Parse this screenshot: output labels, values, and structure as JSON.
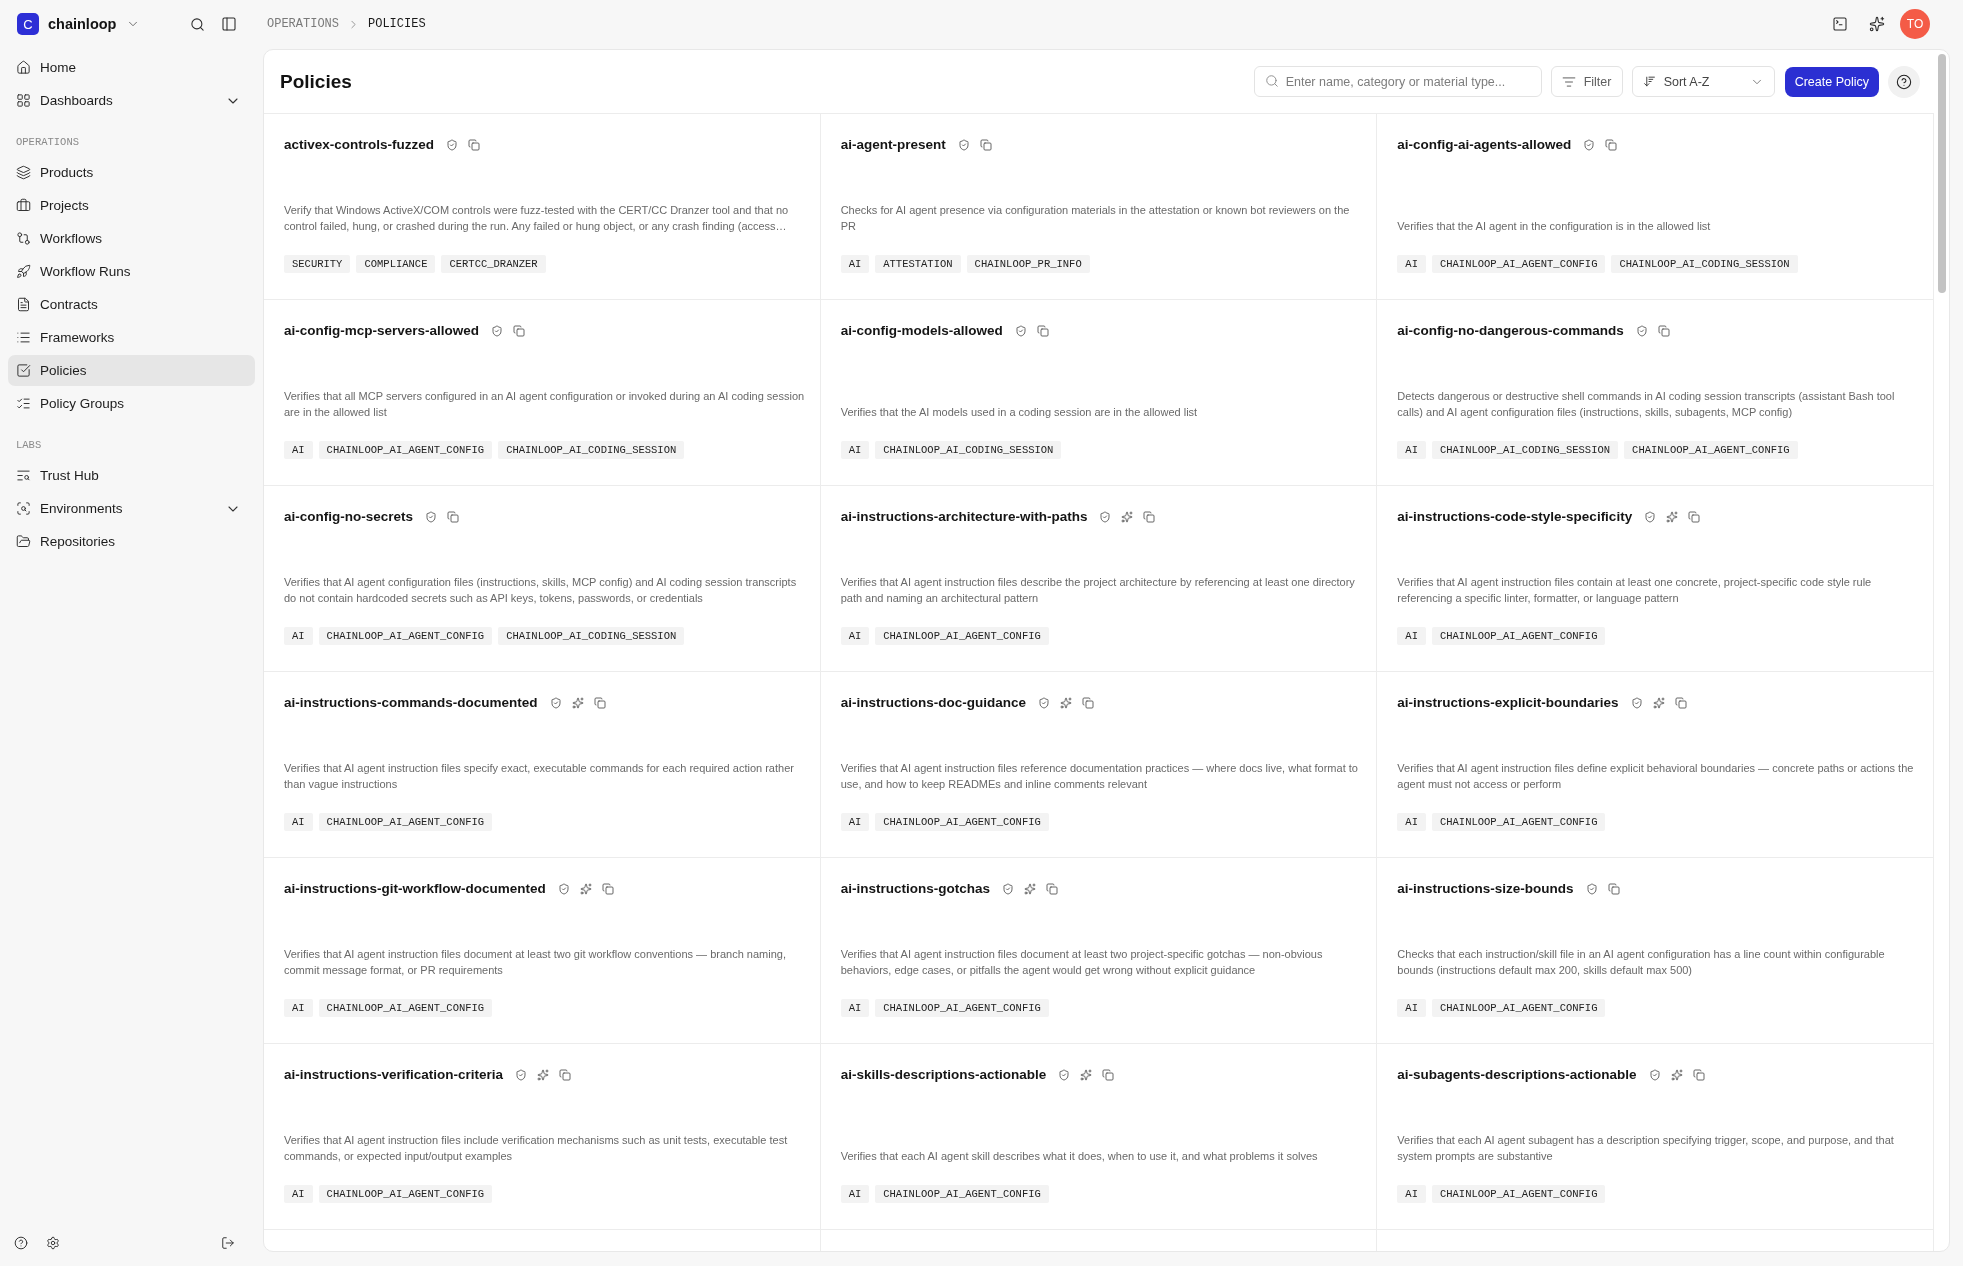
{
  "sidebar": {
    "brand": {
      "initial": "C",
      "name": "chainloop"
    },
    "sections": [
      {
        "items": [
          {
            "label": "Home",
            "selected": false
          },
          {
            "label": "Dashboards",
            "selected": false,
            "expanded": false
          }
        ]
      },
      {
        "title": "OPERATIONS",
        "items": [
          {
            "label": "Products",
            "selected": false
          },
          {
            "label": "Projects",
            "selected": false
          },
          {
            "label": "Workflows",
            "selected": false
          },
          {
            "label": "Workflow Runs",
            "selected": false
          },
          {
            "label": "Contracts",
            "selected": false
          },
          {
            "label": "Frameworks",
            "selected": false
          },
          {
            "label": "Policies",
            "selected": true
          },
          {
            "label": "Policy Groups",
            "selected": false
          }
        ]
      },
      {
        "title": "LABS",
        "items": [
          {
            "label": "Trust Hub",
            "selected": false
          },
          {
            "label": "Environments",
            "selected": false,
            "expanded": false
          },
          {
            "label": "Repositories",
            "selected": false
          }
        ]
      }
    ]
  },
  "breadcrumb": [
    "OPERATIONS",
    "POLICIES"
  ],
  "user": {
    "initials": "TO"
  },
  "page": {
    "title": "Policies",
    "search": {
      "placeholder": "Enter name, category or material type..."
    },
    "filter_button": "Filter",
    "sort": {
      "value": "Sort A-Z"
    },
    "create_button": "Create Policy"
  },
  "policies": [
    {
      "name": "activex-controls-fuzzed",
      "sparkle_badge": false,
      "description": "Verify that Windows ActiveX/COM controls were fuzz-tested with the CERT/CC Dranzer tool and that no control failed, hung, or crashed during the run. Any failed or hung object, or any crash finding (access…",
      "tags": [
        "SECURITY",
        "COMPLIANCE",
        "CERTCC_DRANZER"
      ]
    },
    {
      "name": "ai-agent-present",
      "sparkle_badge": false,
      "description": "Checks for AI agent presence via configuration materials in the attestation or known bot reviewers on the PR",
      "tags": [
        "AI",
        "ATTESTATION",
        "CHAINLOOP_PR_INFO"
      ]
    },
    {
      "name": "ai-config-ai-agents-allowed",
      "sparkle_badge": false,
      "description": "Verifies that the AI agent in the configuration is in the allowed list",
      "tags": [
        "AI",
        "CHAINLOOP_AI_AGENT_CONFIG",
        "CHAINLOOP_AI_CODING_SESSION"
      ]
    },
    {
      "name": "ai-config-mcp-servers-allowed",
      "sparkle_badge": false,
      "description": "Verifies that all MCP servers configured in an AI agent configuration or invoked during an AI coding session are in the allowed list",
      "tags": [
        "AI",
        "CHAINLOOP_AI_AGENT_CONFIG",
        "CHAINLOOP_AI_CODING_SESSION"
      ]
    },
    {
      "name": "ai-config-models-allowed",
      "sparkle_badge": false,
      "description": "Verifies that the AI models used in a coding session are in the allowed list",
      "tags": [
        "AI",
        "CHAINLOOP_AI_CODING_SESSION"
      ]
    },
    {
      "name": "ai-config-no-dangerous-commands",
      "sparkle_badge": false,
      "description": "Detects dangerous or destructive shell commands in AI coding session transcripts (assistant Bash tool calls) and AI agent configuration files (instructions, skills, subagents, MCP config)",
      "tags": [
        "AI",
        "CHAINLOOP_AI_CODING_SESSION",
        "CHAINLOOP_AI_AGENT_CONFIG"
      ]
    },
    {
      "name": "ai-config-no-secrets",
      "sparkle_badge": false,
      "description": "Verifies that AI agent configuration files (instructions, skills, MCP config) and AI coding session transcripts do not contain hardcoded secrets such as API keys, tokens, passwords, or credentials",
      "tags": [
        "AI",
        "CHAINLOOP_AI_AGENT_CONFIG",
        "CHAINLOOP_AI_CODING_SESSION"
      ]
    },
    {
      "name": "ai-instructions-architecture-with-paths",
      "sparkle_badge": true,
      "description": "Verifies that AI agent instruction files describe the project architecture by referencing at least one directory path and naming an architectural pattern",
      "tags": [
        "AI",
        "CHAINLOOP_AI_AGENT_CONFIG"
      ]
    },
    {
      "name": "ai-instructions-code-style-specificity",
      "sparkle_badge": true,
      "description": "Verifies that AI agent instruction files contain at least one concrete, project-specific code style rule referencing a specific linter, formatter, or language pattern",
      "tags": [
        "AI",
        "CHAINLOOP_AI_AGENT_CONFIG"
      ]
    },
    {
      "name": "ai-instructions-commands-documented",
      "sparkle_badge": true,
      "description": "Verifies that AI agent instruction files specify exact, executable commands for each required action rather than vague instructions",
      "tags": [
        "AI",
        "CHAINLOOP_AI_AGENT_CONFIG"
      ]
    },
    {
      "name": "ai-instructions-doc-guidance",
      "sparkle_badge": true,
      "description": "Verifies that AI agent instruction files reference documentation practices — where docs live, what format to use, and how to keep READMEs and inline comments relevant",
      "tags": [
        "AI",
        "CHAINLOOP_AI_AGENT_CONFIG"
      ]
    },
    {
      "name": "ai-instructions-explicit-boundaries",
      "sparkle_badge": true,
      "description": "Verifies that AI agent instruction files define explicit behavioral boundaries — concrete paths or actions the agent must not access or perform",
      "tags": [
        "AI",
        "CHAINLOOP_AI_AGENT_CONFIG"
      ]
    },
    {
      "name": "ai-instructions-git-workflow-documented",
      "sparkle_badge": true,
      "description": "Verifies that AI agent instruction files document at least two git workflow conventions — branch naming, commit message format, or PR requirements",
      "tags": [
        "AI",
        "CHAINLOOP_AI_AGENT_CONFIG"
      ]
    },
    {
      "name": "ai-instructions-gotchas",
      "sparkle_badge": true,
      "description": "Verifies that AI agent instruction files document at least two project-specific gotchas — non-obvious behaviors, edge cases, or pitfalls the agent would get wrong without explicit guidance",
      "tags": [
        "AI",
        "CHAINLOOP_AI_AGENT_CONFIG"
      ]
    },
    {
      "name": "ai-instructions-size-bounds",
      "sparkle_badge": false,
      "description": "Checks that each instruction/skill file in an AI agent configuration has a line count within configurable bounds (instructions default max 200, skills default max 500)",
      "tags": [
        "AI",
        "CHAINLOOP_AI_AGENT_CONFIG"
      ]
    },
    {
      "name": "ai-instructions-verification-criteria",
      "sparkle_badge": true,
      "description": "Verifies that AI agent instruction files include verification mechanisms such as unit tests, executable test commands, or expected input/output examples",
      "tags": [
        "AI",
        "CHAINLOOP_AI_AGENT_CONFIG"
      ]
    },
    {
      "name": "ai-skills-descriptions-actionable",
      "sparkle_badge": true,
      "description": "Verifies that each AI agent skill describes what it does, when to use it, and what problems it solves",
      "tags": [
        "AI",
        "CHAINLOOP_AI_AGENT_CONFIG"
      ]
    },
    {
      "name": "ai-subagents-descriptions-actionable",
      "sparkle_badge": true,
      "description": "Verifies that each AI agent subagent has a description specifying trigger, scope, and purpose, and that system prompts are substantive",
      "tags": [
        "AI",
        "CHAINLOOP_AI_AGENT_CONFIG"
      ]
    }
  ]
}
